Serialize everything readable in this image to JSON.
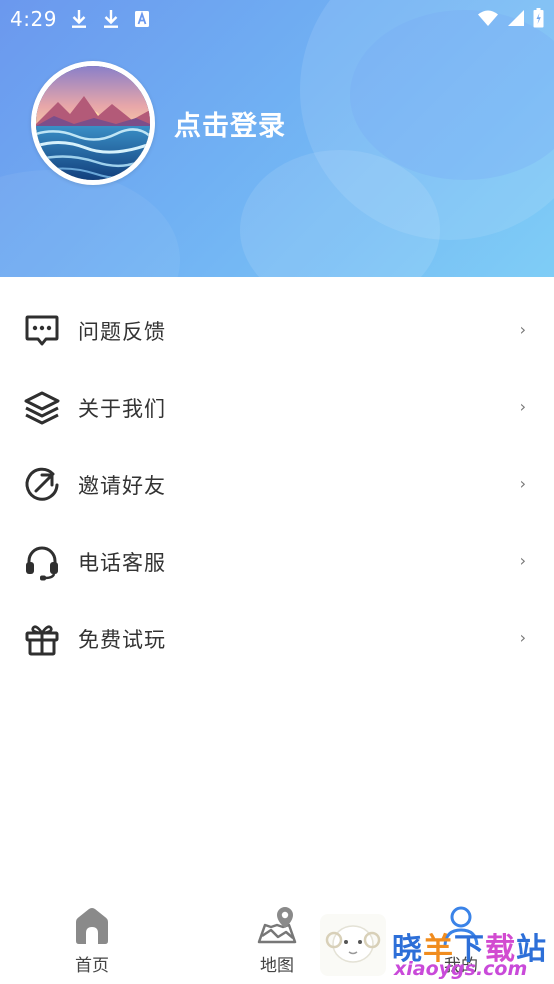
{
  "status_bar": {
    "time": "4:29",
    "left_icons": [
      "download-icon",
      "download-icon",
      "text-a-icon"
    ],
    "right_icons": [
      "wifi-icon",
      "signal-icon",
      "battery-icon"
    ]
  },
  "header": {
    "login_text": "点击登录",
    "gradient": [
      "#6b98ee",
      "#7fcdf6"
    ]
  },
  "menu": {
    "items": [
      {
        "label": "问题反馈",
        "icon": "chat-bubble-icon"
      },
      {
        "label": "关于我们",
        "icon": "layers-icon"
      },
      {
        "label": "邀请好友",
        "icon": "share-arrow-icon"
      },
      {
        "label": "电话客服",
        "icon": "headset-icon"
      },
      {
        "label": "免费试玩",
        "icon": "gift-icon"
      }
    ],
    "chevron": "›"
  },
  "bottom_nav": {
    "items": [
      {
        "label": "首页",
        "icon": "home-icon"
      },
      {
        "label": "地图",
        "icon": "map-icon"
      },
      {
        "label": "我的",
        "icon": "user-icon"
      }
    ]
  },
  "watermark": {
    "title": "晓羊下载站",
    "url": "xiaoygs.com"
  }
}
